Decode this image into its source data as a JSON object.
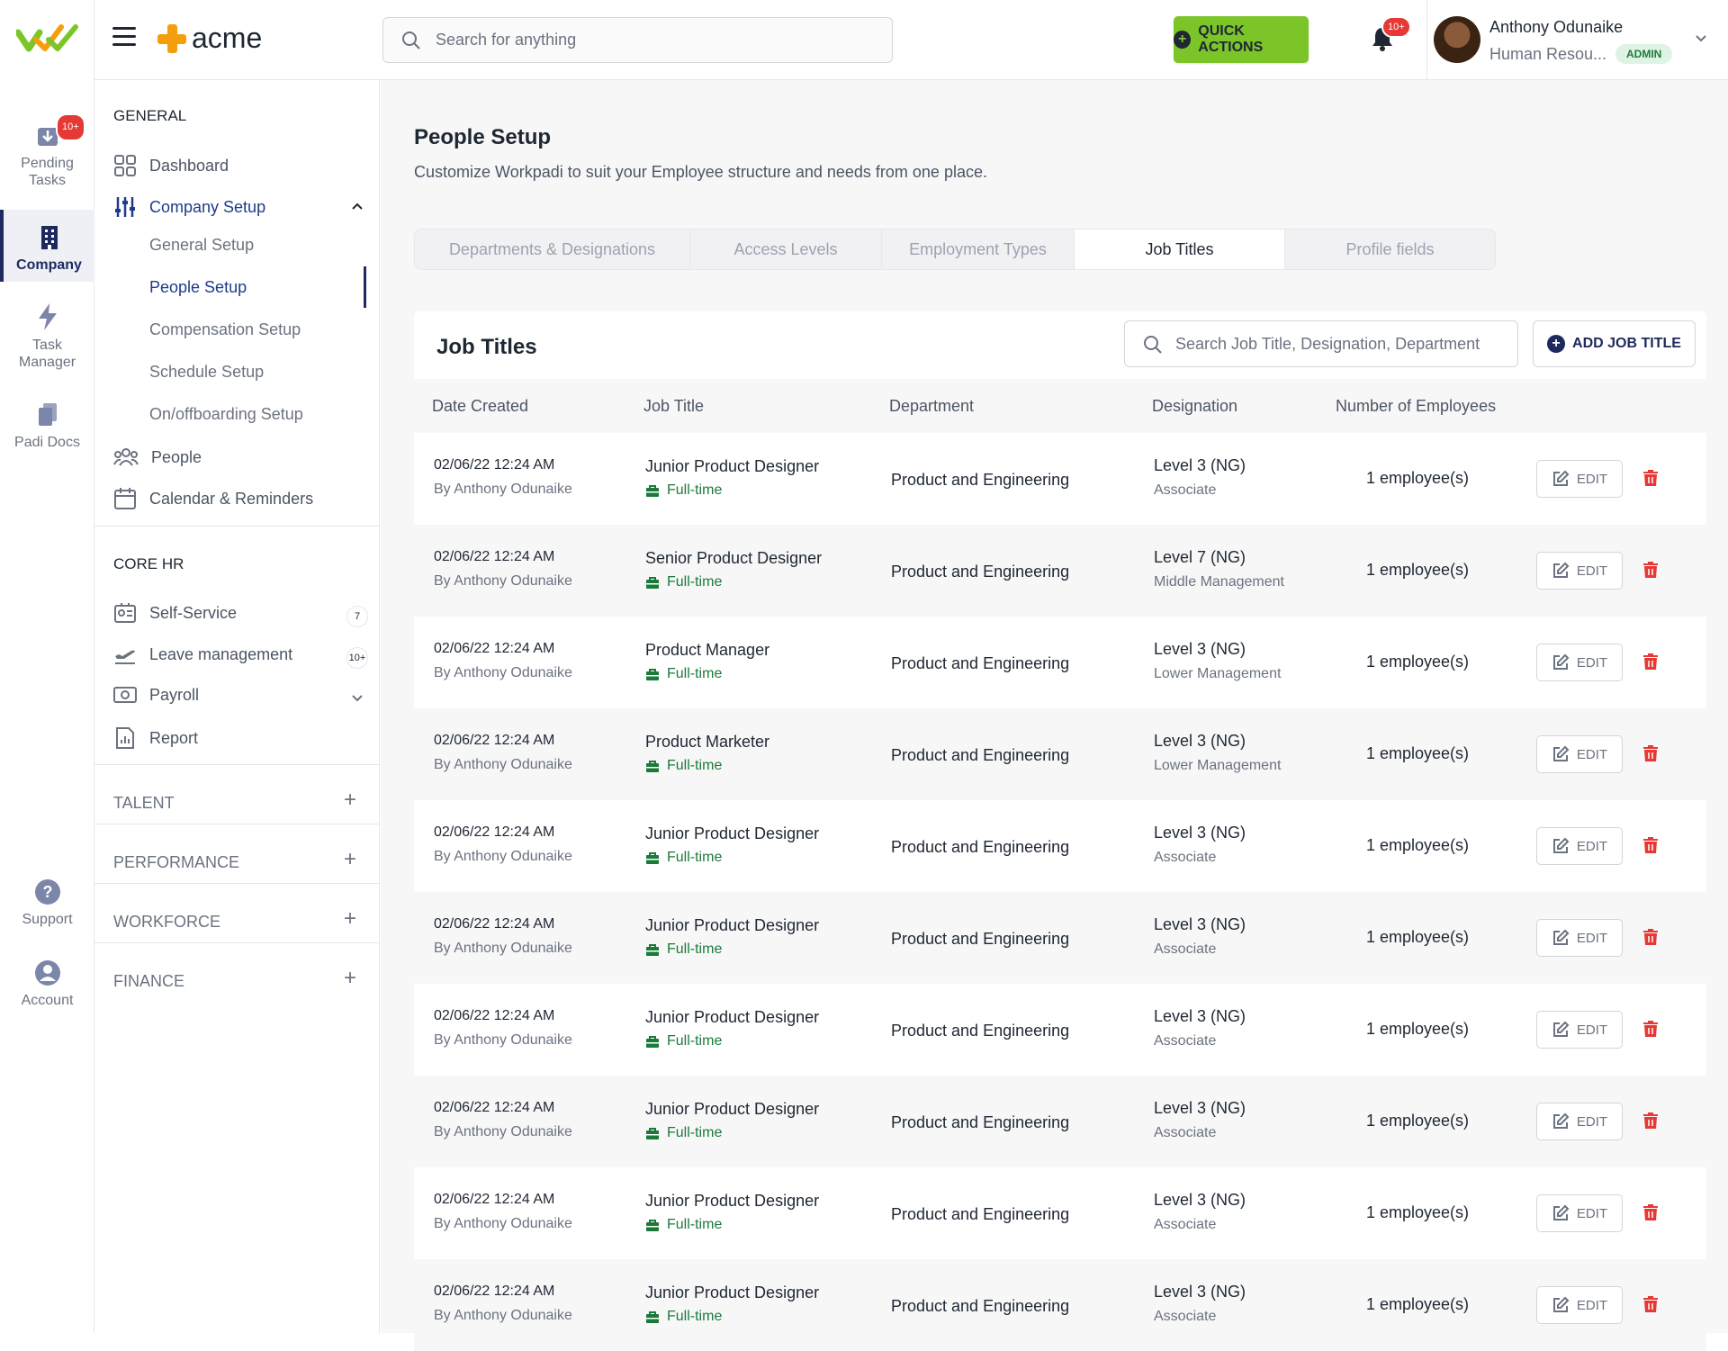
{
  "rail": {
    "items": [
      {
        "label_line1": "Pending",
        "label_line2": "Tasks",
        "badge": "10+"
      },
      {
        "label_line1": "Company",
        "label_line2": ""
      },
      {
        "label_line1": "Task",
        "label_line2": "Manager"
      },
      {
        "label_line1": "Padi Docs",
        "label_line2": ""
      },
      {
        "label_line1": "Support",
        "label_line2": ""
      },
      {
        "label_line1": "Account",
        "label_line2": ""
      }
    ]
  },
  "topbar": {
    "brand": "acme",
    "search_placeholder": "Search for anything",
    "quick_actions": "QUICK ACTIONS",
    "notif_badge": "10+",
    "user_name": "Anthony Odunaike",
    "user_role": "Human Resou...",
    "user_badge": "ADMIN"
  },
  "sidebar": {
    "general": "GENERAL",
    "dashboard": "Dashboard",
    "company_setup": "Company Setup",
    "subs": [
      "General Setup",
      "People Setup",
      "Compensation Setup",
      "Schedule Setup",
      "On/offboarding Setup"
    ],
    "people": "People",
    "calendar": "Calendar & Reminders",
    "core_hr": "CORE HR",
    "self_service": "Self-Service",
    "self_service_count": "7",
    "leave": "Leave management",
    "leave_count": "10+",
    "payroll": "Payroll",
    "report": "Report",
    "groups": [
      "TALENT",
      "PERFORMANCE",
      "WORKFORCE",
      "FINANCE"
    ]
  },
  "page": {
    "title": "People Setup",
    "subtitle": "Customize Workpadi to suit your Employee structure and needs from one place.",
    "tabs": [
      "Departments & Designations",
      "Access Levels",
      "Employment Types",
      "Job Titles",
      "Profile fields"
    ],
    "active_tab": "Job Titles"
  },
  "table": {
    "title": "Job Titles",
    "search_placeholder": "Search Job Title, Designation, Department",
    "add_button": "ADD JOB TITLE",
    "headers": [
      "Date Created",
      "Job Title",
      "Department",
      "Designation",
      "Number of Employees"
    ],
    "edit_label": "EDIT",
    "rows": [
      {
        "date": "02/06/22 12:24 AM",
        "by": "By Anthony Odunaike",
        "title": "Junior Product Designer",
        "type": "Full-time",
        "dept": "Product and Engineering",
        "level": "Level 3 (NG)",
        "designation": "Associate",
        "employees": "1 employee(s)"
      },
      {
        "date": "02/06/22 12:24 AM",
        "by": "By Anthony Odunaike",
        "title": "Senior Product Designer",
        "type": "Full-time",
        "dept": "Product and Engineering",
        "level": "Level 7 (NG)",
        "designation": "Middle Management",
        "employees": "1 employee(s)"
      },
      {
        "date": "02/06/22 12:24 AM",
        "by": "By Anthony Odunaike",
        "title": "Product Manager",
        "type": "Full-time",
        "dept": "Product and Engineering",
        "level": "Level 3 (NG)",
        "designation": "Lower Management",
        "employees": "1 employee(s)"
      },
      {
        "date": "02/06/22 12:24 AM",
        "by": "By Anthony Odunaike",
        "title": "Product Marketer",
        "type": "Full-time",
        "dept": "Product and Engineering",
        "level": "Level 3 (NG)",
        "designation": "Lower Management",
        "employees": "1 employee(s)"
      },
      {
        "date": "02/06/22 12:24 AM",
        "by": "By Anthony Odunaike",
        "title": "Junior Product Designer",
        "type": "Full-time",
        "dept": "Product and Engineering",
        "level": "Level 3 (NG)",
        "designation": "Associate",
        "employees": "1 employee(s)"
      },
      {
        "date": "02/06/22 12:24 AM",
        "by": "By Anthony Odunaike",
        "title": "Junior Product Designer",
        "type": "Full-time",
        "dept": "Product and Engineering",
        "level": "Level 3 (NG)",
        "designation": "Associate",
        "employees": "1 employee(s)"
      },
      {
        "date": "02/06/22 12:24 AM",
        "by": "By Anthony Odunaike",
        "title": "Junior Product Designer",
        "type": "Full-time",
        "dept": "Product and Engineering",
        "level": "Level 3 (NG)",
        "designation": "Associate",
        "employees": "1 employee(s)"
      },
      {
        "date": "02/06/22 12:24 AM",
        "by": "By Anthony Odunaike",
        "title": "Junior Product Designer",
        "type": "Full-time",
        "dept": "Product and Engineering",
        "level": "Level 3 (NG)",
        "designation": "Associate",
        "employees": "1 employee(s)"
      },
      {
        "date": "02/06/22 12:24 AM",
        "by": "By Anthony Odunaike",
        "title": "Junior Product Designer",
        "type": "Full-time",
        "dept": "Product and Engineering",
        "level": "Level 3 (NG)",
        "designation": "Associate",
        "employees": "1 employee(s)"
      },
      {
        "date": "02/06/22 12:24 AM",
        "by": "By Anthony Odunaike",
        "title": "Junior Product Designer",
        "type": "Full-time",
        "dept": "Product and Engineering",
        "level": "Level 3 (NG)",
        "designation": "Associate",
        "employees": "1 employee(s)"
      }
    ]
  },
  "colors": {
    "accent": "#7cc529",
    "brand_navy": "#1e2a5e",
    "brand_orange": "#f59e0b",
    "danger": "#e53935",
    "fulltime_green": "#1b7a3a"
  }
}
